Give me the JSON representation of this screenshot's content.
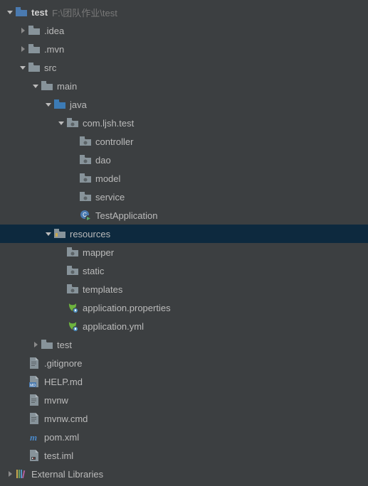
{
  "tree": [
    {
      "depth": 0,
      "arrow": "down",
      "icon": "folder-module",
      "label": "test",
      "bold": true,
      "path": "F:\\团队作业\\test"
    },
    {
      "depth": 1,
      "arrow": "right",
      "icon": "folder",
      "label": ".idea"
    },
    {
      "depth": 1,
      "arrow": "right",
      "icon": "folder",
      "label": ".mvn"
    },
    {
      "depth": 1,
      "arrow": "down",
      "icon": "folder",
      "label": "src"
    },
    {
      "depth": 2,
      "arrow": "down",
      "icon": "folder",
      "label": "main"
    },
    {
      "depth": 3,
      "arrow": "down",
      "icon": "folder-source",
      "label": "java"
    },
    {
      "depth": 4,
      "arrow": "down",
      "icon": "package",
      "label": "com.ljsh.test"
    },
    {
      "depth": 5,
      "arrow": "none",
      "icon": "package",
      "label": "controller"
    },
    {
      "depth": 5,
      "arrow": "none",
      "icon": "package",
      "label": "dao"
    },
    {
      "depth": 5,
      "arrow": "none",
      "icon": "package",
      "label": "model"
    },
    {
      "depth": 5,
      "arrow": "none",
      "icon": "package",
      "label": "service"
    },
    {
      "depth": 5,
      "arrow": "none",
      "icon": "class-run",
      "label": "TestApplication"
    },
    {
      "depth": 3,
      "arrow": "down",
      "icon": "folder-resource",
      "label": "resources",
      "selected": true
    },
    {
      "depth": 4,
      "arrow": "none",
      "icon": "package",
      "label": "mapper"
    },
    {
      "depth": 4,
      "arrow": "none",
      "icon": "package",
      "label": "static"
    },
    {
      "depth": 4,
      "arrow": "none",
      "icon": "package",
      "label": "templates"
    },
    {
      "depth": 4,
      "arrow": "none",
      "icon": "spring-prop",
      "label": "application.properties"
    },
    {
      "depth": 4,
      "arrow": "none",
      "icon": "spring-prop",
      "label": "application.yml"
    },
    {
      "depth": 2,
      "arrow": "right",
      "icon": "folder",
      "label": "test"
    },
    {
      "depth": 1,
      "arrow": "none",
      "icon": "file",
      "label": ".gitignore"
    },
    {
      "depth": 1,
      "arrow": "none",
      "icon": "file-md",
      "label": "HELP.md"
    },
    {
      "depth": 1,
      "arrow": "none",
      "icon": "file",
      "label": "mvnw"
    },
    {
      "depth": 1,
      "arrow": "none",
      "icon": "file",
      "label": "mvnw.cmd"
    },
    {
      "depth": 1,
      "arrow": "none",
      "icon": "file-maven",
      "label": "pom.xml"
    },
    {
      "depth": 1,
      "arrow": "none",
      "icon": "file-idea",
      "label": "test.iml"
    },
    {
      "depth": 0,
      "arrow": "right",
      "icon": "library",
      "label": "External Libraries"
    }
  ]
}
